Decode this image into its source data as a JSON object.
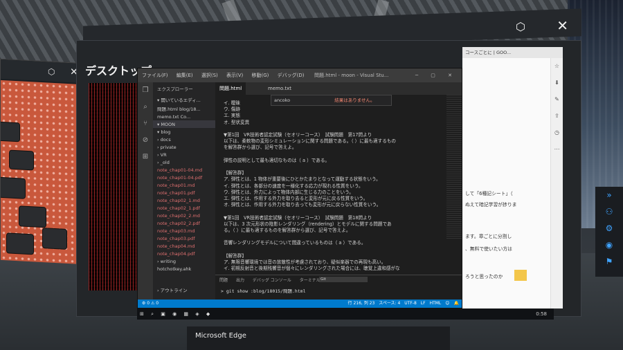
{
  "desktop": {
    "title": "デスクトップ",
    "close": "✕"
  },
  "vscode": {
    "menu": [
      "ファイル(F)",
      "編集(E)",
      "選択(S)",
      "表示(V)",
      "移動(G)",
      "デバッグ(D)"
    ],
    "window_title": "問題.html - moon - Visual Stu...",
    "sidebar": {
      "header": "エクスプローラー",
      "open_editors": "▾ 開いているエディ...",
      "files": [
        "問題.html  blog/18...",
        "memo.txt  Co...",
        "▾ MOON",
        "▾ blog",
        "› docs",
        "› private",
        "› VR",
        "› _old",
        "note_chap01-04.md",
        "note_chap01-04.pdf",
        "note_chap01.md",
        "note_chap01.pdf",
        "note_chap02_1.md",
        "note_chap02_1.pdf",
        "note_chap02_2.md",
        "note_chap02_2.pdf",
        "note_chap03.md",
        "note_chap03.pdf",
        "note_chap04.md",
        "note_chap04.pdf",
        "› writing",
        "hotchotkey.ahk"
      ],
      "outline": "› アウトライン"
    },
    "tabs": [
      "問題.html",
      "memo.txt"
    ],
    "find": {
      "query": "ancoko",
      "result": "結果はありません。"
    },
    "code_lines": [
      "イ. 曖昧",
      "ウ. 傷跡",
      "エ. 実態",
      "オ. 型状変異",
      "",
      "▼第1回　VR技術者認定試験（セオリーコース）　試験問題　第17問より",
      "以下は、柔軟物の変形シミュレーションに関する問題である。（ ）に最も適するもの",
      "を解答群から選び、記号で答えよ。",
      "",
      "弾性の説明として最も適切なものは（ a ）である。",
      "",
      "【解答群】",
      "ア. 弾性とは、1 物体が重要後にひとかたまりとなって運動する状態をいう。",
      "イ. 弾性とは、各部分の速度を一様化する応力が現れる性質をいう。",
      "ウ. 弾性とは、外力によって物体内部に生じる力のことをいう。",
      "エ. 弾性とは、作用する外力を取り去ると変形が元に戻る性質をいう。",
      "オ. 弾性とは、作用する外力を取り去っても変形が元に戻らない性質をいう。",
      "",
      "▼第1回　VR技術者認定試験（セオリーコース）　試験問題　第18問より",
      "以下は、3 次元形状の陰影レンダリング（rendering）とモデルに関する問題であ",
      "る。（ ）に最も適するものを解答群から選び、記号で答えよ。",
      "",
      "音響レンダリングモデルについて間違っているものは（ a ）である。",
      "",
      "【解答群】",
      "ア. 無限音響環境では音の放散性が考慮されており、疑似楽器での再現も高い。",
      "イ. 初期反射音と後期残響音が個々にレンダリングされた場合には、聴覚上違和感がな"
    ],
    "panel_tabs": [
      "問題",
      "出力",
      "デバッグ コンソール",
      "ターミナル"
    ],
    "panel_select": "Git",
    "terminal_cmd": "> git show :blog/18015/問題.html",
    "status_left": "⚙ 0 ⚠ 0",
    "status_right": "行 216, 列 23　スペース: 4　UTF-8　LF　HTML　😊　🔔"
  },
  "browser": {
    "tab": "コースごとに | GOO...",
    "lines": [
      "して「6種記シート」（",
      "ぬえて暗記学習が捗りま",
      "ます。章ごとに分割し",
      "、無料で使いたい方は",
      "ろうと思ったのか"
    ]
  },
  "taskbar": {
    "time": "0:58"
  },
  "edge": {
    "title": "Microsoft Edge"
  },
  "left_window": {
    "close": "✕"
  }
}
